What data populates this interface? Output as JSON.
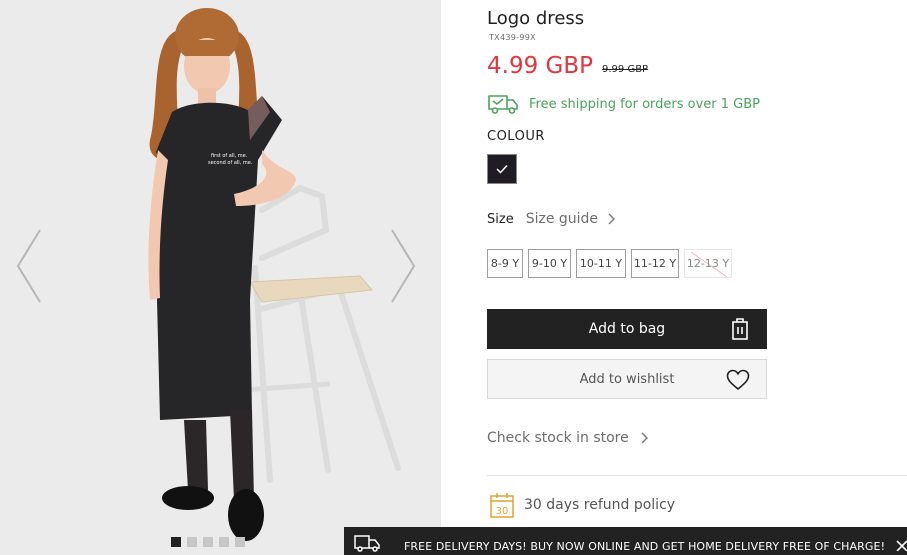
{
  "product": {
    "title": "Logo dress",
    "sku": "TX439-99X",
    "price": "4.99 GBP",
    "old_price": "9.99 GBP",
    "shipping_note": "Free shipping for orders over 1 GBP",
    "colour_label": "COLOUR",
    "colours": [
      {
        "name": "black",
        "hex": "#1f1d23",
        "selected": true
      }
    ],
    "shirt_print": "first of all, me. second of all, me."
  },
  "size": {
    "label": "Size",
    "guide_label": "Size guide",
    "options": [
      {
        "label": "8-9 Y",
        "available": true
      },
      {
        "label": "9-10 Y",
        "available": true
      },
      {
        "label": "10-11 Y",
        "available": true
      },
      {
        "label": "11-12 Y",
        "available": true
      },
      {
        "label": "12-13 Y",
        "available": false
      }
    ]
  },
  "actions": {
    "add_to_bag": "Add to bag",
    "add_to_wishlist": "Add to wishlist",
    "check_stock": "Check stock in store"
  },
  "refund": {
    "badge": "30",
    "text": "30 days refund policy"
  },
  "banner": {
    "text": "FREE DELIVERY DAYS! BUY NOW ONLINE AND GET HOME DELIVERY FREE OF CHARGE!"
  },
  "gallery": {
    "image_count": 5,
    "active_index": 0
  },
  "icons": [
    "chevron-left-icon",
    "chevron-right-icon",
    "truck-icon",
    "checkmark-icon",
    "shopping-bag-icon",
    "heart-icon",
    "calendar-icon",
    "close-icon"
  ],
  "colors": {
    "price_red": "#e5343b",
    "shipping_green": "#4aa35a",
    "button_dark": "#222222",
    "banner_dark": "#222222"
  }
}
